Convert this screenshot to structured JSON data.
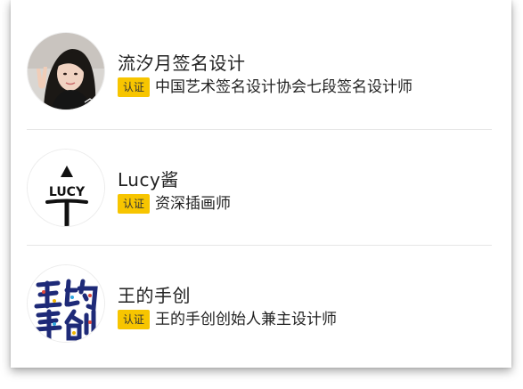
{
  "designers": [
    {
      "name": "流汐月签名设计",
      "badge": "认证",
      "description": "中国艺术签名设计协会七段签名设计师",
      "avatar_icon": "photo-avatar"
    },
    {
      "name": "Lucy酱",
      "badge": "认证",
      "description": "资深插画师",
      "avatar_icon": "lucy-logo",
      "avatar_text": "LUCY"
    },
    {
      "name": "王的手创",
      "badge": "认证",
      "description": "王的手创创始人兼主设计师",
      "avatar_icon": "calligraphy-logo"
    }
  ],
  "colors": {
    "badge_bg": "#f7c500",
    "divider": "#e6e6e6",
    "text": "#222222"
  }
}
